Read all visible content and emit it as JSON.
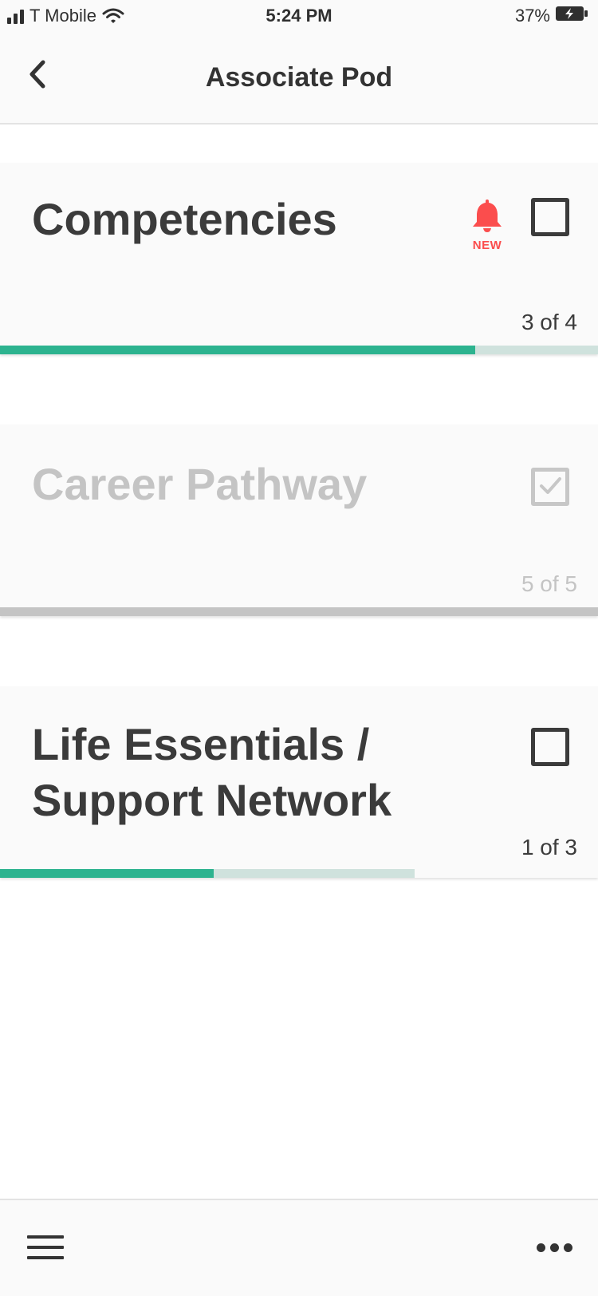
{
  "status_bar": {
    "carrier": "T Mobile",
    "time": "5:24 PM",
    "battery": "37%"
  },
  "header": {
    "title": "Associate Pod"
  },
  "cards": [
    {
      "title": "Competencies",
      "count": "3 of 4",
      "progress": 0.8,
      "badge": "NEW",
      "checked": false
    },
    {
      "title": "Career Pathway",
      "count": "5 of 5",
      "progress": 1.0,
      "checked": true
    },
    {
      "title_line1": "Life Essentials /",
      "title_line2": "Support Network",
      "count": "1 of 3",
      "progress": 0.5,
      "progress_track": 0.69,
      "checked": false
    }
  ],
  "colors": {
    "accent": "#2db38f",
    "track": "#cfe2dd",
    "alert": "#fb4d4d",
    "text": "#3b3b3b",
    "disabled": "#c4c4c4"
  },
  "icons": {
    "back": "chevron-left-icon",
    "bell": "bell-icon",
    "menu": "hamburger-menu-icon",
    "more": "more-horizontal-icon"
  }
}
